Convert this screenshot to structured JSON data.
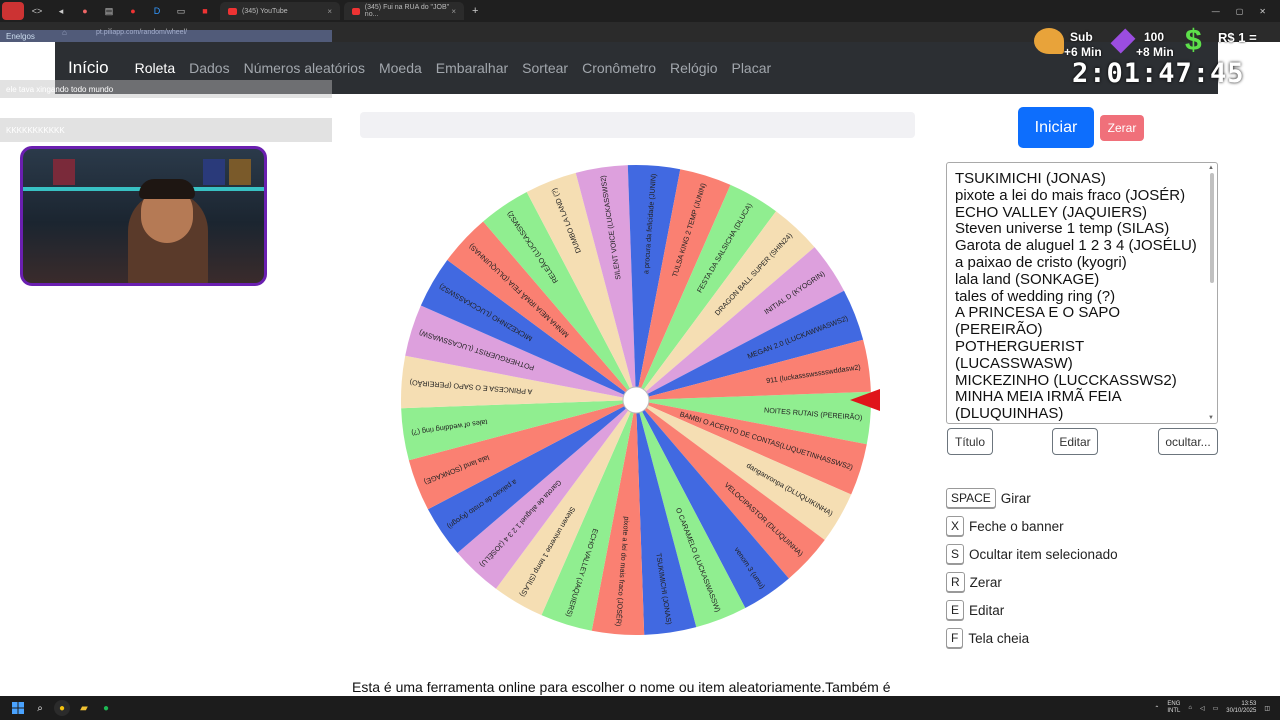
{
  "browser": {
    "tabs": [
      {
        "title": "(345) YouTube"
      },
      {
        "title": "(345) Fui na RUA do \"JOB\" no..."
      }
    ],
    "url": "pt.piliapp.com/random/wheel/",
    "new_tab": "+"
  },
  "nav": {
    "brand": "Início",
    "items": [
      "Roleta",
      "Dados",
      "Números aleatórios",
      "Moeda",
      "Embaralhar",
      "Sortear",
      "Cronômetro",
      "Relógio",
      "Placar"
    ]
  },
  "stream": {
    "chat_lines": [
      "Enelgos",
      "ele tava xingando todo mundo",
      "KKKKKKKKKKK"
    ],
    "sub_label": "Sub",
    "sub_bonus": "+6 Min",
    "gift_count": "100",
    "gift_bonus": "+8 Min",
    "donation": "R$ 1 =",
    "timer": "2:01:47:45"
  },
  "wheel": {
    "segments": [
      {
        "label": "NOITES RUTAIS (PEREIRÃO)",
        "color": "#90ee90"
      },
      {
        "label": "BAMBI O ACERTO DE CONTAS(LUQUETINHASSWS2)",
        "color": "#fa8072"
      },
      {
        "label": "danganronpa (DLUQUIKINHA)",
        "color": "#f5deb3"
      },
      {
        "label": "VELOCIPASTOR (DLUQUINHA)",
        "color": "#fa8072"
      },
      {
        "label": "venom 3 (umu)",
        "color": "#4169e1"
      },
      {
        "label": "O CARAMELO (LUCKASWASSW)",
        "color": "#90ee90"
      },
      {
        "label": "TSUKIMICHI (JONAS)",
        "color": "#4169e1"
      },
      {
        "label": "pixote a lei do mais fraco (JOSÉR)",
        "color": "#fa8072"
      },
      {
        "label": "ECHO VALLEY (JAQUIERS)",
        "color": "#90ee90"
      },
      {
        "label": "Steven universe 1 temp (SILAS)",
        "color": "#f5deb3"
      },
      {
        "label": "Garota de aluguel 1 2 3 4 (JOSÉLU)",
        "color": "#dda0dd"
      },
      {
        "label": "a paixao de cristo (kyogri)",
        "color": "#4169e1"
      },
      {
        "label": "lala land (SONKAGE)",
        "color": "#fa8072"
      },
      {
        "label": "tales of wedding ring (?)",
        "color": "#90ee90"
      },
      {
        "label": "A PRINCESA E O SAPO (PEREIRÃO)",
        "color": "#f5deb3"
      },
      {
        "label": "POTHERGUERIST (LUCASSWASW)",
        "color": "#dda0dd"
      },
      {
        "label": "MICKEZINHO (LUCCKASSWS2)",
        "color": "#4169e1"
      },
      {
        "label": "MINHA MEIA IRMÃ FEIA (DLUQUINHAS)",
        "color": "#fa8072"
      },
      {
        "label": "RELEÃO (LUCKASSWS2)",
        "color": "#90ee90"
      },
      {
        "label": "DUMBO LA LAND (?)",
        "color": "#f5deb3"
      },
      {
        "label": "SILENT VOICE (LUCKASSWS2)",
        "color": "#dda0dd"
      },
      {
        "label": "a procura da felicidade (JUNIN)",
        "color": "#4169e1"
      },
      {
        "label": "TULSA KING 2 TEMP (JUNIN)",
        "color": "#fa8072"
      },
      {
        "label": "FESTA DA SALSICHA (DLUCA)",
        "color": "#90ee90"
      },
      {
        "label": "DRAGON BALL SUPER (SHIN24)",
        "color": "#f5deb3"
      },
      {
        "label": "INITIAL D (KYOGRIN)",
        "color": "#dda0dd"
      },
      {
        "label": "MEGAN 2.0 (LUCKAWWASWS2)",
        "color": "#4169e1"
      },
      {
        "label": "911 (luckassswsssswddasw2)",
        "color": "#fa8072"
      }
    ]
  },
  "controls": {
    "start_label": "Iniciar",
    "reset_label": "Zerar",
    "items_text": "TSUKIMICHI (JONAS)\npixote a lei do mais fraco (JOSÉR)\nECHO VALLEY (JAQUIERS)\nSteven universe 1 temp (SILAS)\nGarota de aluguel 1 2 3 4 (JOSÉLU)\na paixao de cristo (kyogri)\nlala land (SONKAGE)\ntales of wedding ring (?)\nA PRINCESA E O SAPO (PEREIRÃO)\nPOTHERGUERIST (LUCASSWASW)\nMICKEZINHO (LUCCKASSWS2)\nMINHA MEIA IRMÃ FEIA (DLUQUINHAS)",
    "title_label": "Título",
    "edit_label": "Editar",
    "hide_label": "ocultar..."
  },
  "shortcuts": [
    {
      "key": "SPACE",
      "label": "Girar"
    },
    {
      "key": "X",
      "label": "Feche o banner"
    },
    {
      "key": "S",
      "label": "Ocultar item selecionado"
    },
    {
      "key": "R",
      "label": "Zerar"
    },
    {
      "key": "E",
      "label": "Editar"
    },
    {
      "key": "F",
      "label": "Tela cheia"
    }
  ],
  "footer": {
    "text": "Esta é uma ferramenta online para escolher o nome ou item aleatoriamente.Também é"
  },
  "taskbar": {
    "lang": "ENG",
    "lang_sub": "INTL",
    "time": "13:53",
    "date": "30/10/2025"
  },
  "colors": {
    "primary": "#0d6efd",
    "danger": "#f0707a",
    "navbar": "#2c2f33",
    "pointer": "#e0141a"
  }
}
